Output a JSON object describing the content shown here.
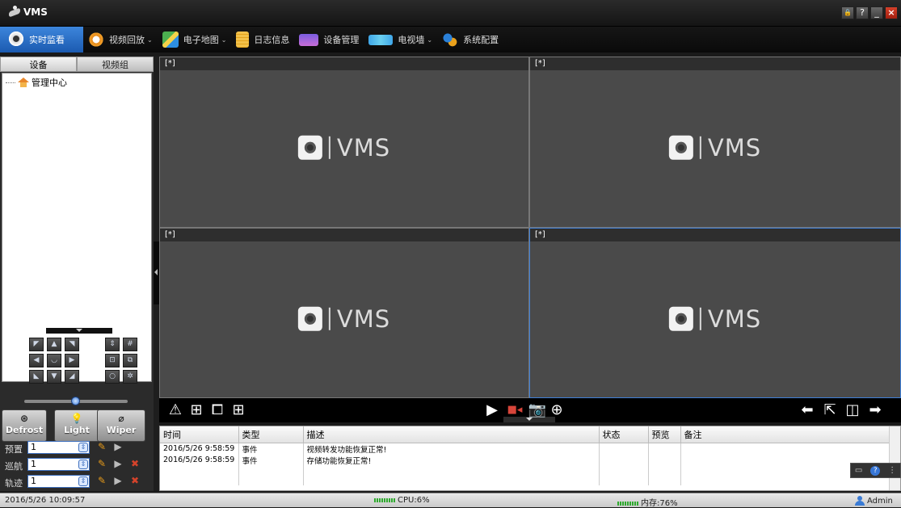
{
  "app": {
    "title": "VMS"
  },
  "window_buttons": {
    "lock": "🔒",
    "help": "?",
    "minimize": "_",
    "close": "×"
  },
  "menu": {
    "items": [
      {
        "label": "实时监看",
        "icon": "webcam-icon",
        "dropdown": false,
        "active": true
      },
      {
        "label": "视频回放",
        "icon": "playback-clock-icon",
        "dropdown": true
      },
      {
        "label": "电子地图",
        "icon": "map-icon",
        "dropdown": true
      },
      {
        "label": "日志信息",
        "icon": "notepad-icon",
        "dropdown": false
      },
      {
        "label": "设备管理",
        "icon": "monitor-icon",
        "dropdown": false
      },
      {
        "label": "电视墙",
        "icon": "tv-wall-icon",
        "dropdown": true
      },
      {
        "label": "系统配置",
        "icon": "gears-icon",
        "dropdown": false
      }
    ]
  },
  "left_panel": {
    "tabs": [
      "设备",
      "视频组"
    ],
    "tree_root": "管理中心"
  },
  "ptz": {
    "buttons": [
      {
        "name": "ptz-up-left",
        "glyph": "◤"
      },
      {
        "name": "ptz-up",
        "glyph": "▲"
      },
      {
        "name": "ptz-up-right",
        "glyph": "◥"
      },
      {
        "name": "ptz-focus",
        "glyph": "⇕"
      },
      {
        "name": "ptz-grid",
        "glyph": "#"
      },
      {
        "name": "ptz-left",
        "glyph": "◀"
      },
      {
        "name": "ptz-auto",
        "glyph": "◡"
      },
      {
        "name": "ptz-right",
        "glyph": "▶"
      },
      {
        "name": "ptz-zoom-in",
        "glyph": "⊡"
      },
      {
        "name": "ptz-zoom-out",
        "glyph": "⧉"
      },
      {
        "name": "ptz-down-left",
        "glyph": "◣"
      },
      {
        "name": "ptz-down",
        "glyph": "▼"
      },
      {
        "name": "ptz-down-right",
        "glyph": "◢"
      },
      {
        "name": "ptz-iris-close",
        "glyph": "○"
      },
      {
        "name": "ptz-iris-open",
        "glyph": "✲"
      }
    ],
    "speed_level": 0.5,
    "controls": [
      {
        "label": "Defrost",
        "symbol": "⊛"
      },
      {
        "label": "Light",
        "symbol": "💡"
      },
      {
        "label": "Wiper",
        "symbol": "⌀"
      }
    ],
    "preset": {
      "label": "预置",
      "value": "1"
    },
    "cruise": {
      "label": "巡航",
      "value": "1"
    },
    "track": {
      "label": "轨迹",
      "value": "1"
    }
  },
  "video": {
    "panes": [
      {
        "header": "[*]",
        "watermark": "VMS",
        "selected": false
      },
      {
        "header": "[*]",
        "watermark": "VMS",
        "selected": false
      },
      {
        "header": "[*]",
        "watermark": "VMS",
        "selected": false
      },
      {
        "header": "[*]",
        "watermark": "VMS",
        "selected": true
      }
    ]
  },
  "toolbar": {
    "left": [
      {
        "name": "alarm-icon",
        "glyph": "⚠"
      },
      {
        "name": "layout-4-icon",
        "glyph": "⊞"
      },
      {
        "name": "fullscreen-icon",
        "glyph": "⧠"
      },
      {
        "name": "layout-grid-icon",
        "glyph": "⊞"
      }
    ],
    "middle": [
      {
        "name": "play-icon",
        "glyph": "▶"
      },
      {
        "name": "record-icon",
        "glyph": "■◂"
      },
      {
        "name": "snapshot-icon",
        "glyph": "📷"
      },
      {
        "name": "zoom-icon",
        "glyph": "⊕"
      }
    ],
    "right": [
      {
        "name": "prev-page-icon",
        "glyph": "⬅"
      },
      {
        "name": "restore-icon",
        "glyph": "⇱"
      },
      {
        "name": "window-icon",
        "glyph": "◫"
      },
      {
        "name": "next-page-icon",
        "glyph": "➡"
      }
    ]
  },
  "log": {
    "columns": [
      "时间",
      "类型",
      "描述",
      "状态",
      "预览",
      "备注"
    ],
    "rows": [
      {
        "time": "2016/5/26 9:58:59",
        "type": "事件",
        "desc": "视频转发功能恢复正常!",
        "status": "",
        "preview": "",
        "note": ""
      },
      {
        "time": "2016/5/26 9:58:59",
        "type": "事件",
        "desc": "存储功能恢复正常!",
        "status": "",
        "preview": "",
        "note": ""
      }
    ]
  },
  "status_bar": {
    "datetime": "2016/5/26 10:09:57",
    "cpu": "CPU:6%",
    "memory": "内存:76%",
    "user": "Admin"
  },
  "colors": {
    "accent": "#2f6fd0",
    "selected_pane": "#3f7fd6",
    "background": "#1a1a1a"
  }
}
